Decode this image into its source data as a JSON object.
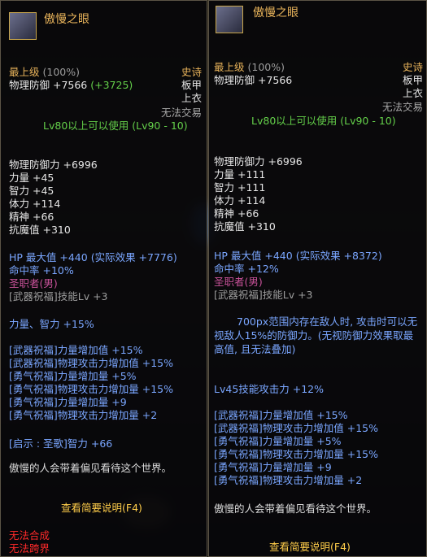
{
  "left": {
    "name": "傲慢之眼",
    "grade": "最上级",
    "grade_pct": "(100%)",
    "rarity": "史诗",
    "phys_def": "物理防御 +7566",
    "phys_def_bonus": "(+3725)",
    "slot": "板甲",
    "slot2": "上衣",
    "trade": "无法交易",
    "level_req": "Lv80以上可以使用 (Lv90 - 10)",
    "stats": [
      "物理防御力 +6996",
      "力量 +45",
      "智力 +45",
      "体力 +114",
      "精神 +66",
      "抗魔值 +310"
    ],
    "hp_line": "HP 最大值 +440 (实际效果 +7776)",
    "hit_line": "命中率 +10%",
    "job": "圣职者(男)",
    "skill_line": "[武器祝福]技能Lv +3",
    "power_line": "力量、智力 +15%",
    "blessings": [
      "[武器祝福]力量增加值 +15%",
      "[武器祝福]物理攻击力增加值 +15%",
      "[勇气祝福]力量增加量 +5%",
      "[勇气祝福]物理攻击力增加量 +15%",
      "[勇气祝福]力量增加量 +9",
      "[勇气祝福]物理攻击力增加量 +2"
    ],
    "revelation": "[启示 : 圣歌]智力 +66",
    "flavor": "傲慢的人会带着偏见看待这个世界。",
    "command": "查看简要说明(F4)",
    "warn1": "无法合成",
    "warn2": "无法跨界"
  },
  "right": {
    "name": "傲慢之眼",
    "grade": "最上级",
    "grade_pct": "(100%)",
    "rarity": "史诗",
    "phys_def": "物理防御 +7566",
    "slot": "板甲",
    "slot2": "上衣",
    "trade": "无法交易",
    "level_req": "Lv80以上可以使用 (Lv90 - 10)",
    "stats": [
      "物理防御力 +6996",
      "力量 +111",
      "智力 +111",
      "体力 +114",
      "精神 +66",
      "抗魔值 +310"
    ],
    "hp_line": "HP 最大值 +440 (实际效果 +8372)",
    "hit_line": "命中率 +12%",
    "job": "圣职者(男)",
    "skill_line": "[武器祝福]技能Lv +3",
    "desc": "700px范围内存在敌人时, 攻击时可以无视敌人15%的防御力。(无视防御力效果取最高值, 且无法叠加)",
    "skill_atk": "Lv45技能攻击力 +12%",
    "blessings": [
      "[武器祝福]力量增加值 +15%",
      "[武器祝福]物理攻击力增加值 +15%",
      "[勇气祝福]力量增加量 +5%",
      "[勇气祝福]物理攻击力增加量 +15%",
      "[勇气祝福]力量增加量 +9",
      "[勇气祝福]物理攻击力增加量 +2"
    ],
    "flavor": "傲慢的人会带着偏见看待这个世界。",
    "command": "查看简要说明(F4)"
  },
  "colors": {
    "title": "#e9b45b",
    "green": "#64d04a",
    "blue": "#7aa6ff",
    "pink": "#c9529a",
    "red": "#ff2a2a"
  }
}
